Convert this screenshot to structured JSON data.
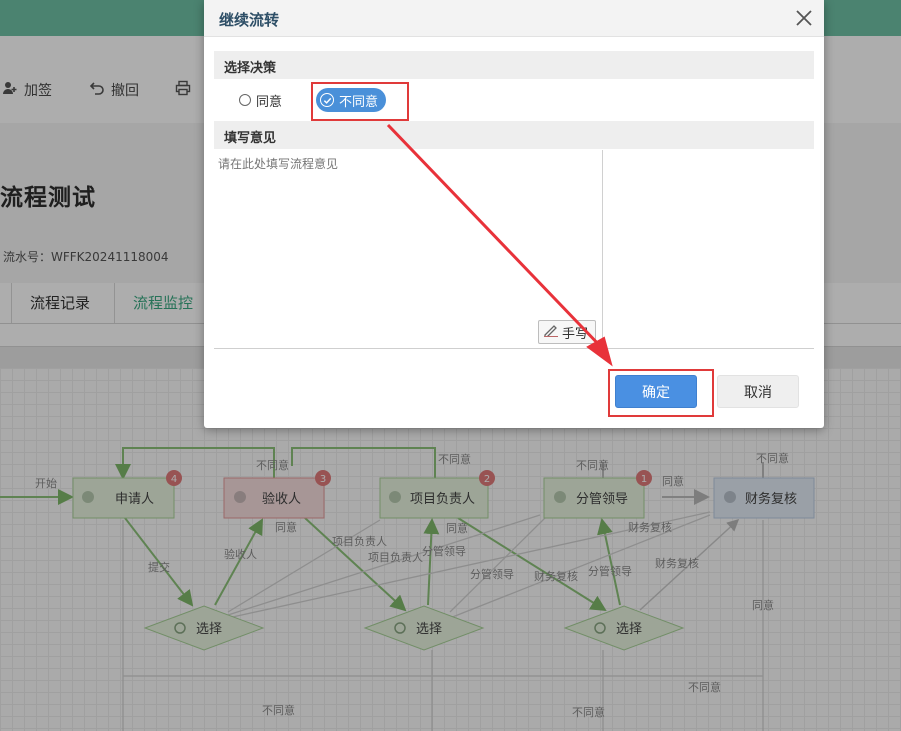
{
  "toolbar": {
    "items": [
      {
        "label": "加签",
        "icon": "add-user-icon"
      },
      {
        "label": "撤回",
        "icon": "undo-icon"
      },
      {
        "label": "",
        "icon": "print-icon"
      }
    ]
  },
  "page": {
    "title": "流程测试",
    "serial": "流水号：WFFK20241118004"
  },
  "tabs": [
    {
      "label": "流程记录",
      "active": false
    },
    {
      "label": "流程监控",
      "active": true
    }
  ],
  "flow": {
    "nodes": [
      {
        "label": "申请人",
        "badge": "4",
        "state": "done"
      },
      {
        "label": "验收人",
        "badge": "3",
        "state": "rejected"
      },
      {
        "label": "项目负责人",
        "badge": "2",
        "state": "done"
      },
      {
        "label": "分管领导",
        "badge": "1",
        "state": "done"
      },
      {
        "label": "财务复核",
        "badge": "",
        "state": "pending"
      }
    ],
    "start_label": "开始",
    "gateway_label": "选择",
    "edge_labels": [
      "不同意",
      "不同意",
      "不同意",
      "不同意",
      "同意",
      "提交",
      "验收人",
      "同意",
      "项目负责人",
      "项目负责人",
      "分管领导",
      "同意",
      "分管领导",
      "财务复核",
      "分管领导",
      "财务复核",
      "财务复核",
      "同意",
      "不同意",
      "不同意",
      "不同意"
    ]
  },
  "dialog": {
    "title": "继续流转",
    "decision_label": "选择决策",
    "options": [
      {
        "label": "同意",
        "selected": false
      },
      {
        "label": "不同意",
        "selected": true
      }
    ],
    "opinion_label": "填写意见",
    "opinion_placeholder": "请在此处填写流程意见",
    "sign_label": "手写",
    "ok_label": "确定",
    "cancel_label": "取消"
  },
  "colors": {
    "header_bar": "#6fc2a6",
    "node_done": "#e7f3df",
    "node_rejected": "#f6dede",
    "node_pending": "#e3ecf6",
    "badge": "#e07b7b",
    "primary": "#4a90e2",
    "highlight": "#e03a3a"
  }
}
